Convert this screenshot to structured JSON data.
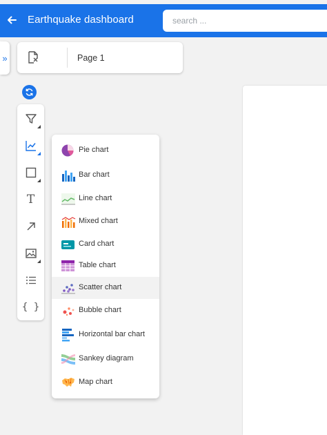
{
  "header": {
    "title": "Earthquake dashboard",
    "search_placeholder": "search ..."
  },
  "sidebar_toggle": {
    "icon": "double-chevron-right-icon",
    "glyph": "»"
  },
  "page_tab": {
    "label": "Page 1",
    "icon": "add-page-icon"
  },
  "toolbar": {
    "items": [
      {
        "name": "filter",
        "icon": "filter-icon"
      },
      {
        "name": "chart",
        "icon": "chart-icon"
      },
      {
        "name": "shape",
        "icon": "square-icon"
      },
      {
        "name": "text",
        "icon": "text-icon",
        "glyph": "T"
      },
      {
        "name": "arrow",
        "icon": "arrow-icon"
      },
      {
        "name": "image",
        "icon": "image-icon"
      },
      {
        "name": "list",
        "icon": "list-icon"
      },
      {
        "name": "code",
        "icon": "braces-icon",
        "glyph": "{ }"
      }
    ]
  },
  "chart_menu": {
    "items": [
      {
        "label": "Pie chart",
        "icon": "pie-chart-icon"
      },
      {
        "label": "Bar chart",
        "icon": "bar-chart-icon"
      },
      {
        "label": "Line chart",
        "icon": "line-chart-icon"
      },
      {
        "label": "Mixed chart",
        "icon": "mixed-chart-icon"
      },
      {
        "label": "Card chart",
        "icon": "card-chart-icon"
      },
      {
        "label": "Table chart",
        "icon": "table-chart-icon"
      },
      {
        "label": "Scatter chart",
        "icon": "scatter-chart-icon"
      },
      {
        "label": "Bubble chart",
        "icon": "bubble-chart-icon"
      },
      {
        "label": "Horizontal bar chart",
        "icon": "horizontal-bar-chart-icon"
      },
      {
        "label": "Sankey diagram",
        "icon": "sankey-diagram-icon"
      },
      {
        "label": "Map chart",
        "icon": "map-chart-icon"
      }
    ],
    "highlighted": "Scatter chart"
  },
  "colors": {
    "primary": "#1a73e8",
    "background": "#f2f2f2",
    "panel": "#ffffff",
    "highlight": "#f2f2f2"
  }
}
